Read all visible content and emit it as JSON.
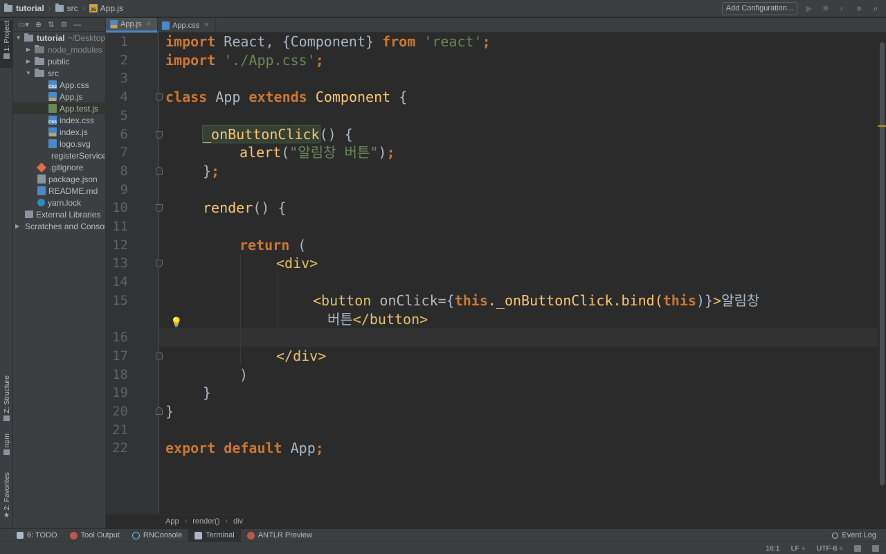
{
  "navbar": {
    "crumbs": [
      "tutorial",
      "src",
      "App.js"
    ],
    "add_configuration": "Add Configuration..."
  },
  "left_strip": {
    "project": "1: Project",
    "structure": "Z: Structure",
    "npm": "npm",
    "favorites": "2: Favorites"
  },
  "project_tree": {
    "root_name": "tutorial",
    "root_path": "~/Desktop",
    "items": [
      {
        "label": "node_modules",
        "type": "folder-excluded"
      },
      {
        "label": "public",
        "type": "folder"
      },
      {
        "label": "src",
        "type": "folder-open"
      },
      {
        "label": "App.css",
        "type": "css"
      },
      {
        "label": "App.js",
        "type": "js"
      },
      {
        "label": "App.test.js",
        "type": "test"
      },
      {
        "label": "index.css",
        "type": "css"
      },
      {
        "label": "index.js",
        "type": "js"
      },
      {
        "label": "logo.svg",
        "type": "svg"
      },
      {
        "label": "registerServiceWorker.js",
        "type": "js"
      },
      {
        "label": ".gitignore",
        "type": "git"
      },
      {
        "label": "package.json",
        "type": "json"
      },
      {
        "label": "README.md",
        "type": "md"
      },
      {
        "label": "yarn.lock",
        "type": "yarn"
      },
      {
        "label": "External Libraries",
        "type": "lib"
      },
      {
        "label": "Scratches and Consoles",
        "type": "scratch"
      }
    ]
  },
  "tabs": [
    {
      "label": "App.js",
      "active": true
    },
    {
      "label": "App.css",
      "active": false
    }
  ],
  "editor": {
    "line_numbers": [
      "1",
      "2",
      "3",
      "4",
      "5",
      "6",
      "7",
      "8",
      "9",
      "10",
      "11",
      "12",
      "13",
      "14",
      "15",
      "",
      "16",
      "17",
      "18",
      "19",
      "20",
      "21",
      "22"
    ],
    "code": {
      "l1": {
        "a": "import",
        "b": " React, {Component} ",
        "c": "from",
        "d": " ",
        "e": "'react'",
        "f": ";"
      },
      "l2": {
        "a": "import",
        "b": " ",
        "c": "'./App.css'",
        "d": ";"
      },
      "l4": {
        "a": "class",
        "b": " App ",
        "c": "extends",
        "d": " ",
        "e": "Component",
        "f": " {"
      },
      "l6": {
        "a": "_onButtonClick",
        "b": "() {"
      },
      "l7": {
        "a": "alert",
        "b": "(",
        "c": "\"알림창 버튼\"",
        "d": ")",
        "e": ";"
      },
      "l8": {
        "a": "}",
        "b": ";"
      },
      "l10": {
        "a": "render",
        "b": "() {"
      },
      "l12": {
        "a": "return",
        "b": " ("
      },
      "l13": {
        "a": "<div>"
      },
      "l15": {
        "a": "<button",
        "b": " onClick",
        "c": "={",
        "d": "this",
        "e": "._onButtonClick.bind(",
        "f": "this",
        "g": ")}",
        "h": ">",
        "i": "알림창"
      },
      "l15b": {
        "a": "버튼",
        "b": "</button>"
      },
      "l17": {
        "a": "</div>"
      },
      "l18": {
        "a": ")"
      },
      "l19": {
        "a": "}"
      },
      "l20": {
        "a": "}"
      },
      "l22": {
        "a": "export",
        "b": " ",
        "c": "default",
        "d": " App",
        "e": ";"
      }
    }
  },
  "code_breadcrumb": [
    "App",
    "render()",
    "div"
  ],
  "bottom_bar": {
    "todo": "6: TODO",
    "tool_output": "Tool Output",
    "rnconsole": "RNConsole",
    "terminal": "Terminal",
    "antlr": "ANTLR Preview",
    "event_log": "Event Log"
  },
  "status_bar": {
    "position": "16:1",
    "line_sep": "LF ÷",
    "encoding": "UTF-8 ÷"
  }
}
